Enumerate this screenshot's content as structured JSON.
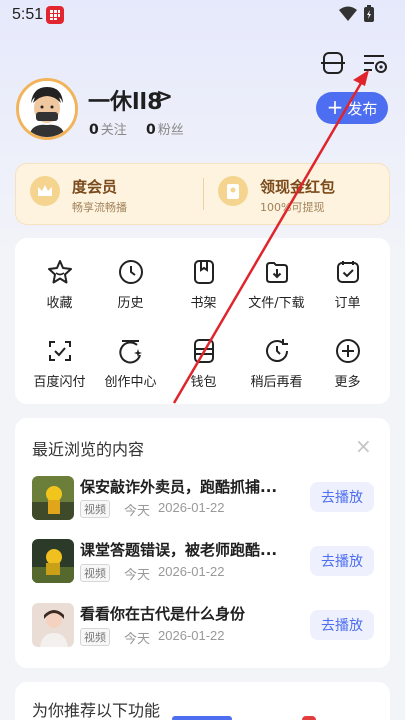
{
  "status_bar": {
    "time": "5:51"
  },
  "header": {
    "scan_icon": "scan-icon",
    "settings_icon": "settings-icon"
  },
  "profile": {
    "username": "一休ll8",
    "chevron": ">",
    "following_count": "0",
    "following_label": "关注",
    "fans_count": "0",
    "fans_label": "粉丝",
    "publish_plus": "+",
    "publish_label": "发布"
  },
  "vip": {
    "member_title": "度会员",
    "member_sub": "畅享流畅播",
    "cash_title": "领现金红包",
    "cash_sub": "100%可提现"
  },
  "grid": {
    "items": [
      {
        "label": "收藏",
        "icon": "star-icon"
      },
      {
        "label": "历史",
        "icon": "clock-icon"
      },
      {
        "label": "书架",
        "icon": "bookshelf-icon"
      },
      {
        "label": "文件/下载",
        "icon": "download-icon"
      },
      {
        "label": "订单",
        "icon": "order-icon"
      },
      {
        "label": "百度闪付",
        "icon": "scan-pay-icon"
      },
      {
        "label": "创作中心",
        "icon": "creation-icon"
      },
      {
        "label": "钱包",
        "icon": "wallet-icon"
      },
      {
        "label": "稍后再看",
        "icon": "watch-later-icon"
      },
      {
        "label": "更多",
        "icon": "plus-circle-icon"
      }
    ]
  },
  "recent": {
    "title": "最近浏览的内容",
    "close": "×",
    "items": [
      {
        "title": "保安敲诈外卖员，跑酷抓捕...",
        "tag": "视频",
        "day": "今天",
        "date": "2026-01-22",
        "action": "去播放"
      },
      {
        "title": "课堂答题错误，被老师跑酷...",
        "tag": "视频",
        "day": "今天",
        "date": "2026-01-22",
        "action": "去播放"
      },
      {
        "title": "看看你在古代是什么身份",
        "tag": "视频",
        "day": "今天",
        "date": "2026-01-22",
        "action": "去播放"
      }
    ]
  },
  "recommend": {
    "title": "为你推荐以下功能"
  },
  "colors": {
    "accent": "#4e6ef2",
    "vip_text": "#7a4a1b",
    "annotation_arrow": "#e0242c"
  }
}
